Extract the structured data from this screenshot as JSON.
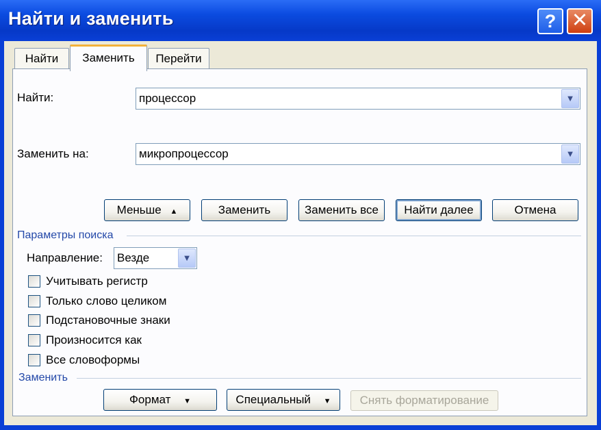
{
  "window": {
    "title": "Найти и заменить",
    "help_label": "?",
    "close_label": "✕"
  },
  "tabs": [
    {
      "label": "Найти",
      "active": false
    },
    {
      "label": "Заменить",
      "active": true
    },
    {
      "label": "Перейти",
      "active": false
    }
  ],
  "find": {
    "label": "Найти:",
    "value": "процессор"
  },
  "replace": {
    "label": "Заменить на:",
    "value": "микропроцессор"
  },
  "buttons": {
    "less": "Меньше",
    "less_arrow": "▲",
    "replace": "Заменить",
    "replace_all": "Заменить все",
    "find_next": "Найти далее",
    "cancel": "Отмена"
  },
  "search_options": {
    "section_label": "Параметры поиска",
    "direction_label": "Направление:",
    "direction_value": "Везде",
    "checkboxes": [
      {
        "label": "Учитывать регистр",
        "checked": false
      },
      {
        "label": "Только слово целиком",
        "checked": false
      },
      {
        "label": "Подстановочные знаки",
        "checked": false
      },
      {
        "label": "Произносится как",
        "checked": false
      },
      {
        "label": "Все словоформы",
        "checked": false
      }
    ]
  },
  "replace_section": {
    "section_label": "Заменить",
    "format_label": "Формат",
    "special_label": "Специальный",
    "dropdown_arrow": "▼",
    "clear_formatting_label": "Снять форматирование"
  },
  "colors": {
    "titlebar": "#0a3fd6",
    "dialog_bg": "#ece9d8",
    "section_text": "#2348a8",
    "active_tab_accent": "#f3b13a",
    "close_button": "#cf3f10"
  },
  "icons": {
    "dropdown": "chevron-down-icon",
    "help": "help-icon",
    "close": "close-icon"
  }
}
